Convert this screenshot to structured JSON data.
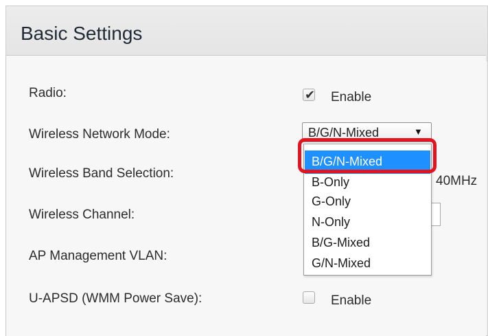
{
  "page": {
    "title": "Basic Settings"
  },
  "form": {
    "radio": {
      "label": "Radio:",
      "checked": true,
      "option_label": "Enable"
    },
    "network_mode": {
      "label": "Wireless Network Mode:",
      "selected": "B/G/N-Mixed",
      "arrow_icon": "triangle-down-icon",
      "options": [
        "B/G/N-Mixed",
        "B-Only",
        "G-Only",
        "N-Only",
        "B/G-Mixed",
        "G/N-Mixed"
      ],
      "highlighted_option": "B/G/N-Mixed"
    },
    "band_selection": {
      "label": "Wireless Band Selection:",
      "partial_value": "40MHz"
    },
    "channel": {
      "label": "Wireless Channel:"
    },
    "ap_vlan": {
      "label": "AP Management VLAN:"
    },
    "uapsd": {
      "label": "U-APSD (WMM Power Save):",
      "checked": false,
      "option_label": "Enable"
    }
  },
  "colors": {
    "selection": "#1e90ff",
    "annotation": "#e3131f",
    "title_text": "#1f2a36"
  }
}
